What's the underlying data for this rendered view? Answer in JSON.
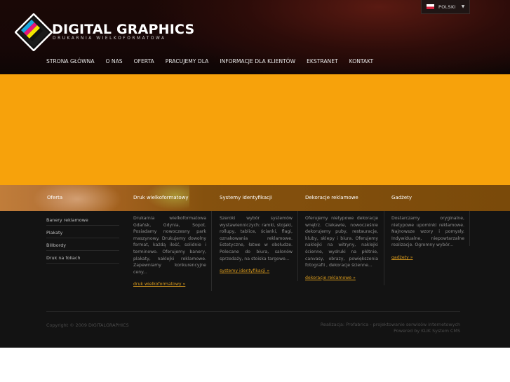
{
  "header": {
    "logo_title": "DIGITAL GRAPHICS",
    "logo_subtitle": "DRUKARNIA WIELKOFORMATOWA",
    "language": "POLSKI",
    "nav": [
      "STRONA GŁÓWNA",
      "O NAS",
      "OFERTA",
      "PRACUJEMY DLA",
      "INFORMACJE DLA KLIENTÓW",
      "EKSTRANET",
      "KONTAKT"
    ]
  },
  "columns": {
    "heads": [
      "Oferta",
      "Druk wielkoformatowy",
      "Systemy identyfikacji",
      "Dekoracje reklamowe",
      "Gadżety"
    ],
    "sidebar": [
      "Banery reklamowe",
      "Plakaty",
      "Billbordy",
      "Druk na foliach"
    ],
    "druk": {
      "text": "Drukarnia wielkoformatowa Gdańsk, Gdynia, Sopot. Posiadamy nowoczesny park maszynowy. Drukujemy dowolny format, każdą ilość, solidnie i terminowo. Oferujemy banery, plakaty, naklejki reklamowe. Zapewniamy konkurencyjne ceny...",
      "link": "druk wielkoformatowy »"
    },
    "systemy": {
      "text": "Szeroki wybór systemów wystawienniczych: ramki, stojaki, rollupy, tablice, ścianki, flagi, oznakowania reklamowe. Estetyczne, łatwe w obsłudze. Polecane do biura, salonów sprzedaży, na stoiska targowe...",
      "link": "systemy identyfikacji »"
    },
    "dekoracje": {
      "text": "Oferujemy nietypowe dekoracje wnętrz. Ciekawie, nowocześnie dekorujemy puby, restauracje, kluby, sklepy i biura. Oferujemy naklejki na witryny, naklejki ścienne, wydruki na płótnie, canvasy, obrazy, powiększenia fotografii , dekoracje ścienne...",
      "link": "dekoracje reklamowe »"
    },
    "gadzety": {
      "text": "Dostarczamy oryginalne, nietypowe upominki reklamowe. Najnowsze wzory i pomysły. Indywidualne, niepowtarzalne realizacje. Ogromny wybór...",
      "link": "gadżety »"
    }
  },
  "footer": {
    "copyright": "Copyright © 2009 DIGITALGRAPHICS",
    "credit1": "Realizacja: Profabrica - projektowanie serwisów internetowych",
    "credit2": "Powered by KLIK System CMS"
  },
  "colors": {
    "banner": "#f7a20b",
    "link": "#d99a1c",
    "body_bg": "#131313"
  }
}
